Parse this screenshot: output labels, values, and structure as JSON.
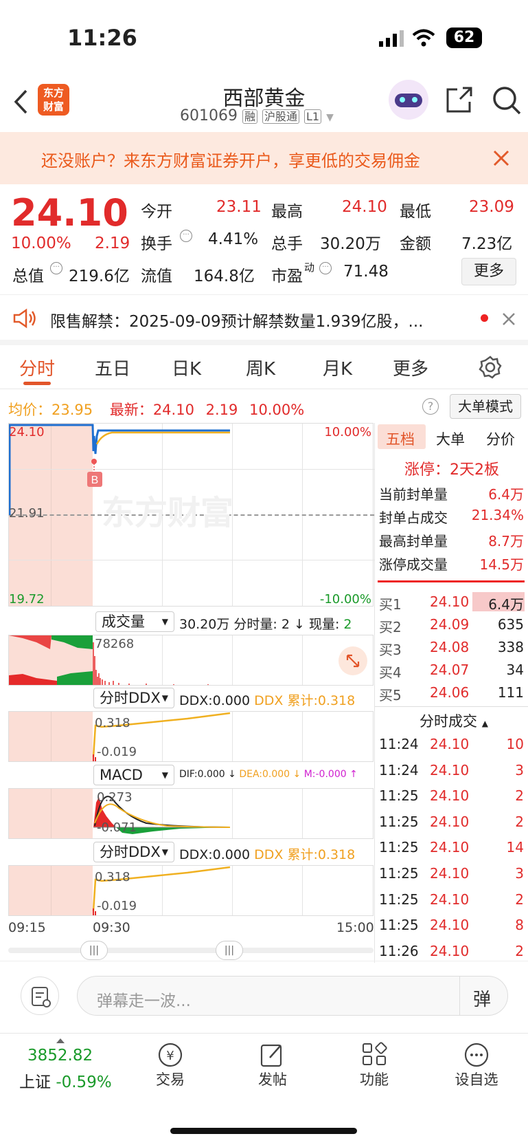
{
  "status_bar": {
    "time": "11:26",
    "battery": "62"
  },
  "header": {
    "title": "西部黄金",
    "code": "601069",
    "tags": [
      "融",
      "沪股通",
      "L1"
    ],
    "logo_text": [
      "东方",
      "财富"
    ]
  },
  "banner": {
    "text": "还没账户？来东方财富证券开户，享更低的交易佣金"
  },
  "quote": {
    "price": "24.10",
    "change_pct": "10.00%",
    "change_amt": "2.19",
    "open_label": "今开",
    "open": "23.11",
    "high_label": "最高",
    "high": "24.10",
    "low_label": "最低",
    "low": "23.09",
    "turnover_label": "换手",
    "turnover": "4.41%",
    "volume_label": "总手",
    "volume": "30.20万",
    "amount_label": "金额",
    "amount": "7.23亿",
    "mktcap_label": "总值",
    "mktcap": "219.6亿",
    "float_label": "流值",
    "float": "164.8亿",
    "pe_label": "市盈",
    "pe_sup": "动",
    "pe": "71.48",
    "more": "更多"
  },
  "notice": {
    "text": "限售解禁：2025-09-09预计解禁数量1.939亿股，..."
  },
  "tabs": [
    "分时",
    "五日",
    "日K",
    "周K",
    "月K",
    "更多"
  ],
  "summary": {
    "avg_label": "均价：",
    "avg": "23.95",
    "latest_label": "最新：",
    "latest": "24.10",
    "chg": "2.19",
    "pct": "10.00%",
    "mode_btn": "大单模式"
  },
  "chart": {
    "y_top": "24.10",
    "y_mid": "21.91",
    "y_bot": "19.72",
    "pct_top": "10.00%",
    "pct_bot": "-10.00%",
    "marker": "B",
    "watermark": "东方财富",
    "vol_selector": "成交量",
    "vol_info": "30.20万 分时量: 2 ↓ 现量: ",
    "vol_now": "2",
    "vol_max": "78268",
    "ddx_selector": "分时DDX",
    "ddx_val": "DDX:0.000",
    "ddx_cum": "DDX 累计:0.318",
    "ddx_hi": "0.318",
    "ddx_lo": "-0.019",
    "macd_selector": "MACD",
    "dif": "DIF:0.000 ↓",
    "dea": "DEA:0.000 ↓",
    "m": "M:-0.000 ↑",
    "macd_hi": "0.273",
    "macd_lo": "-0.071",
    "x_start": "09:15",
    "x_mid": "09:30",
    "x_end": "15:00"
  },
  "side": {
    "tabs": [
      "五档",
      "大单",
      "分价"
    ],
    "limit": "涨停：2天2板",
    "seal_rows": [
      {
        "label": "当前封单量",
        "value": "6.4万"
      },
      {
        "label": "封单占成交",
        "value": "21.34%"
      },
      {
        "label": "最高封单量",
        "value": "8.7万"
      },
      {
        "label": "涨停成交量",
        "value": "14.5万"
      }
    ],
    "bids": [
      {
        "label": "买1",
        "price": "24.10",
        "vol": "6.4万"
      },
      {
        "label": "买2",
        "price": "24.09",
        "vol": "635"
      },
      {
        "label": "买3",
        "price": "24.08",
        "vol": "338"
      },
      {
        "label": "买4",
        "price": "24.07",
        "vol": "34"
      },
      {
        "label": "买5",
        "price": "24.06",
        "vol": "111"
      }
    ],
    "ticks_title": "分时成交",
    "ticks": [
      {
        "t": "11:24",
        "p": "24.10",
        "v": "10"
      },
      {
        "t": "11:24",
        "p": "24.10",
        "v": "3"
      },
      {
        "t": "11:25",
        "p": "24.10",
        "v": "2"
      },
      {
        "t": "11:25",
        "p": "24.10",
        "v": "2"
      },
      {
        "t": "11:25",
        "p": "24.10",
        "v": "14"
      },
      {
        "t": "11:25",
        "p": "24.10",
        "v": "3"
      },
      {
        "t": "11:25",
        "p": "24.10",
        "v": "2"
      },
      {
        "t": "11:25",
        "p": "24.10",
        "v": "8"
      },
      {
        "t": "11:26",
        "p": "24.10",
        "v": "2"
      }
    ]
  },
  "comment": {
    "placeholder": "弹幕走一波...",
    "danmu": "弹"
  },
  "bottom": {
    "index_val": "3852.82",
    "index_name": "上证",
    "index_pct": "-0.59%",
    "items": [
      "交易",
      "发帖",
      "功能",
      "设自选"
    ]
  }
}
